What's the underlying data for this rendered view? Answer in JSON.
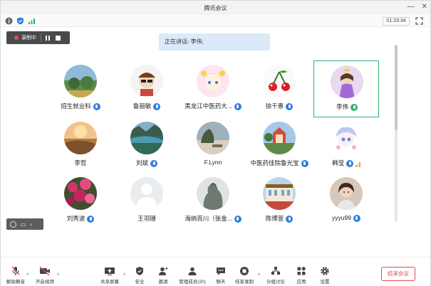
{
  "window": {
    "title": "腾讯会议"
  },
  "status": {
    "timer": "01:23:34"
  },
  "recording": {
    "label": "录制中"
  },
  "speaking": {
    "text": "正在讲话: 李伟;"
  },
  "participants": [
    {
      "name": "招生就业科",
      "mic": "blue"
    },
    {
      "name": "鲁丽敏",
      "mic": "blue"
    },
    {
      "name": "黑龙江中医药大...",
      "mic": "blue"
    },
    {
      "name": "徐千惠",
      "mic": "blue"
    },
    {
      "name": "李伟",
      "mic": "green",
      "active": true
    },
    {
      "name": "李哲",
      "mic": "none"
    },
    {
      "name": "刘斌",
      "mic": "blue"
    },
    {
      "name": "F.Lynn",
      "mic": "none"
    },
    {
      "name": "中医药佳院鲁光宝",
      "mic": "blue"
    },
    {
      "name": "韩莹",
      "mic": "blue",
      "signal": true
    },
    {
      "name": "刘秀波",
      "mic": "blue"
    },
    {
      "name": "王羽珊",
      "mic": "none"
    },
    {
      "name": "海纳百川（张金...",
      "mic": "blue"
    },
    {
      "name": "陈博萱",
      "mic": "blue"
    },
    {
      "name": "yyyu99",
      "mic": "blue"
    }
  ],
  "toolbar": {
    "unmute": "解除静音",
    "video": "开启视频",
    "share": "共享屏幕",
    "security": "安全",
    "invite": "邀请",
    "members": "管理成员(20)",
    "chat": "聊天",
    "stop_record": "结束录制",
    "breakout": "分组讨论",
    "apps": "应用",
    "settings": "设置",
    "end_meeting": "结束会议"
  },
  "colors": {
    "accent": "#2f7de1",
    "active": "#2fb36a",
    "danger": "#e34a4a"
  }
}
